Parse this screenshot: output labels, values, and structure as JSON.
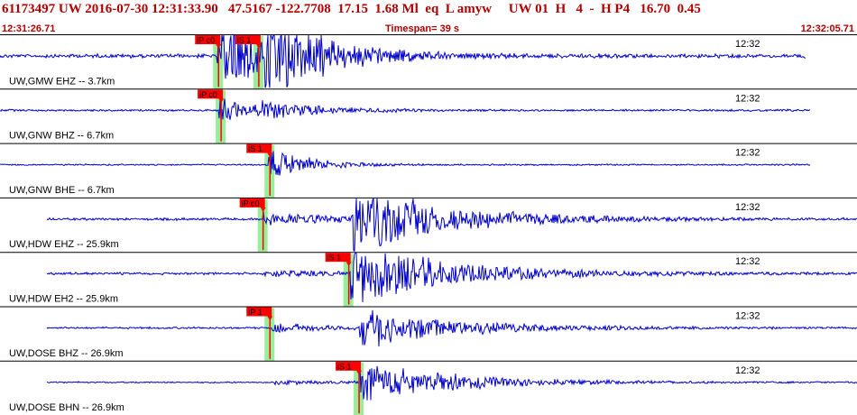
{
  "header": {
    "title": "61173497 UW 2016-07-30 12:31:33.90   47.5167 -122.7708  17.15  1.68 Ml  eq  L amyw     UW 01  H   4  -  H P4   16.70  0.45",
    "start_time": "12:31:26.71",
    "timespan": "Timespan=  39 s",
    "end_time": "12:32:05.71"
  },
  "colors": {
    "trace": "#0000cc",
    "pick_box": "#ff0000",
    "pick_band": "#99ee99",
    "title": "#b00000"
  },
  "panels": [
    {
      "label": "UW,GMW EHZ -- 3.7km",
      "time_label": "12:32",
      "trace_start": 0.0,
      "trace_end": 0.94,
      "amp": 0.08,
      "events": [
        {
          "t": 0.253,
          "a": 2.4,
          "d": 0.05
        },
        {
          "t": 0.308,
          "a": 1.8,
          "d": 0.08
        }
      ],
      "picks": [
        {
          "label": "iP c0",
          "t": 0.255
        },
        {
          "label": "iS 1",
          "t": 0.302
        }
      ]
    },
    {
      "label": "UW,GNW BHZ -- 6.7km",
      "time_label": "12:32",
      "trace_start": 0.0,
      "trace_end": 0.945,
      "amp": 0.04,
      "events": [
        {
          "t": 0.255,
          "a": 0.6,
          "d": 0.05
        },
        {
          "t": 0.305,
          "a": 0.3,
          "d": 0.08
        }
      ],
      "picks": [
        {
          "label": "iP c0",
          "t": 0.258
        }
      ]
    },
    {
      "label": "UW,GNW BHE -- 6.7km",
      "time_label": "12:32",
      "trace_start": 0.0,
      "trace_end": 0.945,
      "amp": 0.03,
      "events": [
        {
          "t": 0.313,
          "a": 0.8,
          "d": 0.05
        }
      ],
      "picks": [
        {
          "label": "iS 1",
          "t": 0.315
        }
      ]
    },
    {
      "label": "UW,HDW EHZ -- 25.9km",
      "time_label": "12:32",
      "trace_start": 0.055,
      "trace_end": 1.0,
      "amp": 0.05,
      "events": [
        {
          "t": 0.307,
          "a": 0.3,
          "d": 0.1
        },
        {
          "t": 0.41,
          "a": 1.6,
          "d": 0.12
        }
      ],
      "picks": [
        {
          "label": "iP c0",
          "t": 0.307
        }
      ]
    },
    {
      "label": "UW,HDW EH2 -- 25.9km",
      "time_label": "12:32",
      "trace_start": 0.055,
      "trace_end": 1.0,
      "amp": 0.05,
      "events": [
        {
          "t": 0.308,
          "a": 0.15,
          "d": 0.08
        },
        {
          "t": 0.409,
          "a": 1.5,
          "d": 0.12
        }
      ],
      "picks": [
        {
          "label": "iS 1",
          "t": 0.407
        }
      ]
    },
    {
      "label": "UW,DOSE BHZ -- 26.9km",
      "time_label": "12:32",
      "trace_start": 0.055,
      "trace_end": 1.0,
      "amp": 0.04,
      "events": [
        {
          "t": 0.317,
          "a": 0.2,
          "d": 0.08
        },
        {
          "t": 0.418,
          "a": 0.9,
          "d": 0.12
        }
      ],
      "picks": [
        {
          "label": "iP 1",
          "t": 0.315
        }
      ]
    },
    {
      "label": "UW,DOSE BHN -- 26.9km",
      "time_label": "12:32",
      "trace_start": 0.055,
      "trace_end": 1.0,
      "amp": 0.03,
      "events": [
        {
          "t": 0.32,
          "a": 0.1,
          "d": 0.08
        },
        {
          "t": 0.419,
          "a": 0.9,
          "d": 0.12
        }
      ],
      "picks": [
        {
          "label": "iS 1",
          "t": 0.419
        }
      ]
    }
  ]
}
